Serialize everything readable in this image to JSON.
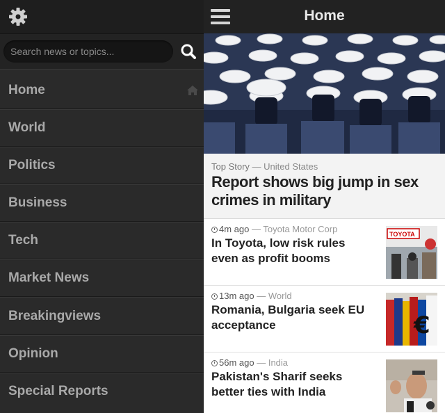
{
  "sidebar": {
    "search_placeholder": "Search news or topics...",
    "items": [
      {
        "label": "Home"
      },
      {
        "label": "World"
      },
      {
        "label": "Politics"
      },
      {
        "label": "Business"
      },
      {
        "label": "Tech"
      },
      {
        "label": "Market News"
      },
      {
        "label": "Breakingviews"
      },
      {
        "label": "Opinion"
      },
      {
        "label": "Special Reports"
      }
    ]
  },
  "header": {
    "title": "Home"
  },
  "top_story": {
    "kicker": "Top Story",
    "section": "United States",
    "headline": "Report shows big jump in sex crimes in military"
  },
  "stories": [
    {
      "time": "4m ago",
      "section": "Toyota Motor Corp",
      "headline": "In Toyota, low risk rules even as profit booms"
    },
    {
      "time": "13m ago",
      "section": "World",
      "headline": "Romania, Bulgaria seek EU acceptance"
    },
    {
      "time": "56m ago",
      "section": "India",
      "headline": "Pakistan's Sharif seeks better ties with India"
    }
  ],
  "thumb_text": {
    "toyota": "TOYOTA"
  },
  "colors": {
    "sidebar_bg": "#2a2a2a",
    "nav_text": "#a9a9a9",
    "topbar_bg": "#222222",
    "headline": "#222222"
  }
}
